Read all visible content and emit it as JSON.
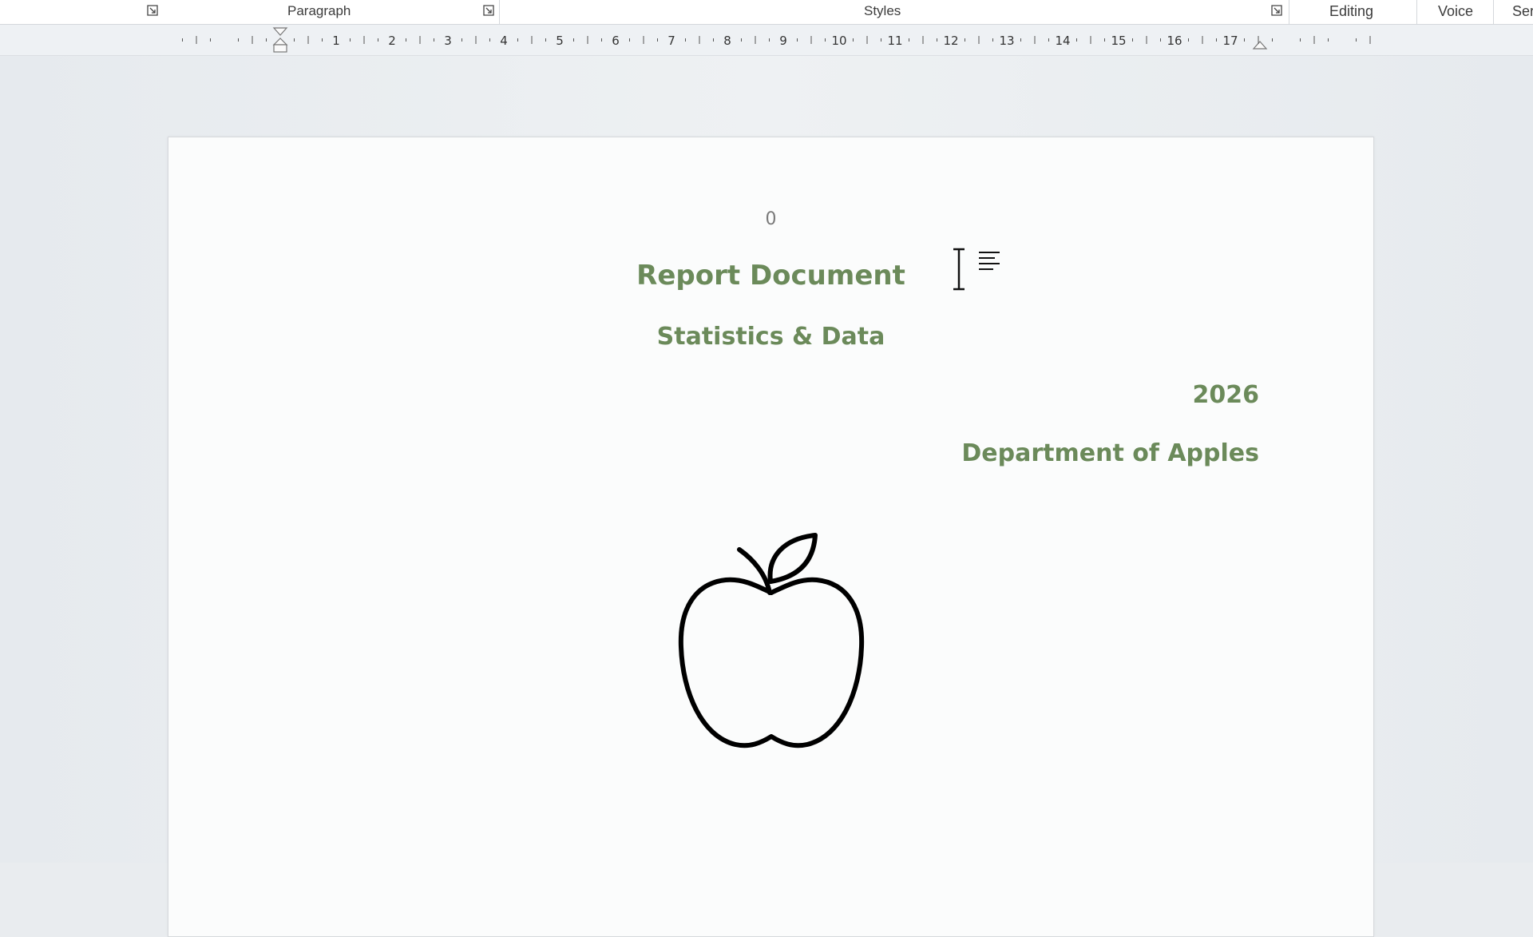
{
  "ribbon": {
    "paragraph_label": "Paragraph",
    "styles_label": "Styles",
    "editing_label": "Editing",
    "voice_label": "Voice",
    "sensitivity_label_partial": "Ser"
  },
  "document": {
    "page_number": "0",
    "title": "Report Document",
    "subtitle": "Statistics & Data",
    "year": "2026",
    "department": "Department of Apples"
  },
  "ruler": {
    "numbers": [
      "1",
      "2",
      "3",
      "4",
      "5",
      "6",
      "7",
      "8",
      "9",
      "10",
      "11",
      "12",
      "13",
      "14",
      "15",
      "16",
      "17"
    ]
  },
  "icons": {
    "apple": "apple-outline-icon",
    "dialog_launcher": "dialog-launcher-icon",
    "text_cursor": "i-beam-cursor-icon"
  },
  "colors": {
    "heading_green": "#6b8a5a",
    "page_background": "#fbfcfc",
    "workspace_background": "#e9ecef"
  }
}
